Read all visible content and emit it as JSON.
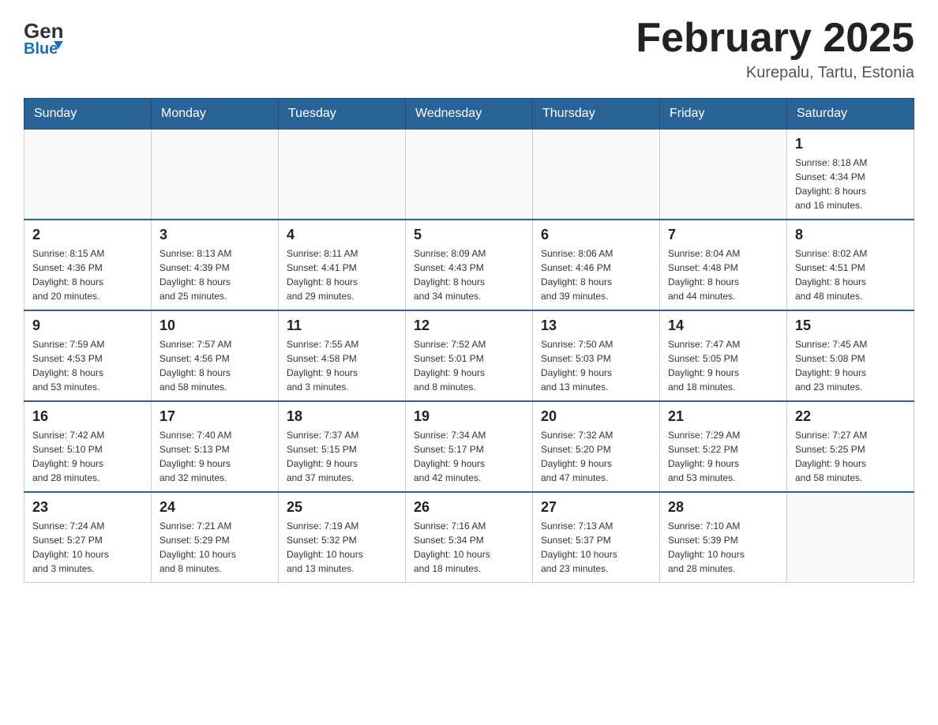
{
  "header": {
    "logo_general": "General",
    "logo_blue": "Blue",
    "month_year": "February 2025",
    "location": "Kurepalu, Tartu, Estonia"
  },
  "weekdays": [
    "Sunday",
    "Monday",
    "Tuesday",
    "Wednesday",
    "Thursday",
    "Friday",
    "Saturday"
  ],
  "weeks": [
    [
      {
        "day": "",
        "info": ""
      },
      {
        "day": "",
        "info": ""
      },
      {
        "day": "",
        "info": ""
      },
      {
        "day": "",
        "info": ""
      },
      {
        "day": "",
        "info": ""
      },
      {
        "day": "",
        "info": ""
      },
      {
        "day": "1",
        "info": "Sunrise: 8:18 AM\nSunset: 4:34 PM\nDaylight: 8 hours\nand 16 minutes."
      }
    ],
    [
      {
        "day": "2",
        "info": "Sunrise: 8:15 AM\nSunset: 4:36 PM\nDaylight: 8 hours\nand 20 minutes."
      },
      {
        "day": "3",
        "info": "Sunrise: 8:13 AM\nSunset: 4:39 PM\nDaylight: 8 hours\nand 25 minutes."
      },
      {
        "day": "4",
        "info": "Sunrise: 8:11 AM\nSunset: 4:41 PM\nDaylight: 8 hours\nand 29 minutes."
      },
      {
        "day": "5",
        "info": "Sunrise: 8:09 AM\nSunset: 4:43 PM\nDaylight: 8 hours\nand 34 minutes."
      },
      {
        "day": "6",
        "info": "Sunrise: 8:06 AM\nSunset: 4:46 PM\nDaylight: 8 hours\nand 39 minutes."
      },
      {
        "day": "7",
        "info": "Sunrise: 8:04 AM\nSunset: 4:48 PM\nDaylight: 8 hours\nand 44 minutes."
      },
      {
        "day": "8",
        "info": "Sunrise: 8:02 AM\nSunset: 4:51 PM\nDaylight: 8 hours\nand 48 minutes."
      }
    ],
    [
      {
        "day": "9",
        "info": "Sunrise: 7:59 AM\nSunset: 4:53 PM\nDaylight: 8 hours\nand 53 minutes."
      },
      {
        "day": "10",
        "info": "Sunrise: 7:57 AM\nSunset: 4:56 PM\nDaylight: 8 hours\nand 58 minutes."
      },
      {
        "day": "11",
        "info": "Sunrise: 7:55 AM\nSunset: 4:58 PM\nDaylight: 9 hours\nand 3 minutes."
      },
      {
        "day": "12",
        "info": "Sunrise: 7:52 AM\nSunset: 5:01 PM\nDaylight: 9 hours\nand 8 minutes."
      },
      {
        "day": "13",
        "info": "Sunrise: 7:50 AM\nSunset: 5:03 PM\nDaylight: 9 hours\nand 13 minutes."
      },
      {
        "day": "14",
        "info": "Sunrise: 7:47 AM\nSunset: 5:05 PM\nDaylight: 9 hours\nand 18 minutes."
      },
      {
        "day": "15",
        "info": "Sunrise: 7:45 AM\nSunset: 5:08 PM\nDaylight: 9 hours\nand 23 minutes."
      }
    ],
    [
      {
        "day": "16",
        "info": "Sunrise: 7:42 AM\nSunset: 5:10 PM\nDaylight: 9 hours\nand 28 minutes."
      },
      {
        "day": "17",
        "info": "Sunrise: 7:40 AM\nSunset: 5:13 PM\nDaylight: 9 hours\nand 32 minutes."
      },
      {
        "day": "18",
        "info": "Sunrise: 7:37 AM\nSunset: 5:15 PM\nDaylight: 9 hours\nand 37 minutes."
      },
      {
        "day": "19",
        "info": "Sunrise: 7:34 AM\nSunset: 5:17 PM\nDaylight: 9 hours\nand 42 minutes."
      },
      {
        "day": "20",
        "info": "Sunrise: 7:32 AM\nSunset: 5:20 PM\nDaylight: 9 hours\nand 47 minutes."
      },
      {
        "day": "21",
        "info": "Sunrise: 7:29 AM\nSunset: 5:22 PM\nDaylight: 9 hours\nand 53 minutes."
      },
      {
        "day": "22",
        "info": "Sunrise: 7:27 AM\nSunset: 5:25 PM\nDaylight: 9 hours\nand 58 minutes."
      }
    ],
    [
      {
        "day": "23",
        "info": "Sunrise: 7:24 AM\nSunset: 5:27 PM\nDaylight: 10 hours\nand 3 minutes."
      },
      {
        "day": "24",
        "info": "Sunrise: 7:21 AM\nSunset: 5:29 PM\nDaylight: 10 hours\nand 8 minutes."
      },
      {
        "day": "25",
        "info": "Sunrise: 7:19 AM\nSunset: 5:32 PM\nDaylight: 10 hours\nand 13 minutes."
      },
      {
        "day": "26",
        "info": "Sunrise: 7:16 AM\nSunset: 5:34 PM\nDaylight: 10 hours\nand 18 minutes."
      },
      {
        "day": "27",
        "info": "Sunrise: 7:13 AM\nSunset: 5:37 PM\nDaylight: 10 hours\nand 23 minutes."
      },
      {
        "day": "28",
        "info": "Sunrise: 7:10 AM\nSunset: 5:39 PM\nDaylight: 10 hours\nand 28 minutes."
      },
      {
        "day": "",
        "info": ""
      }
    ]
  ]
}
